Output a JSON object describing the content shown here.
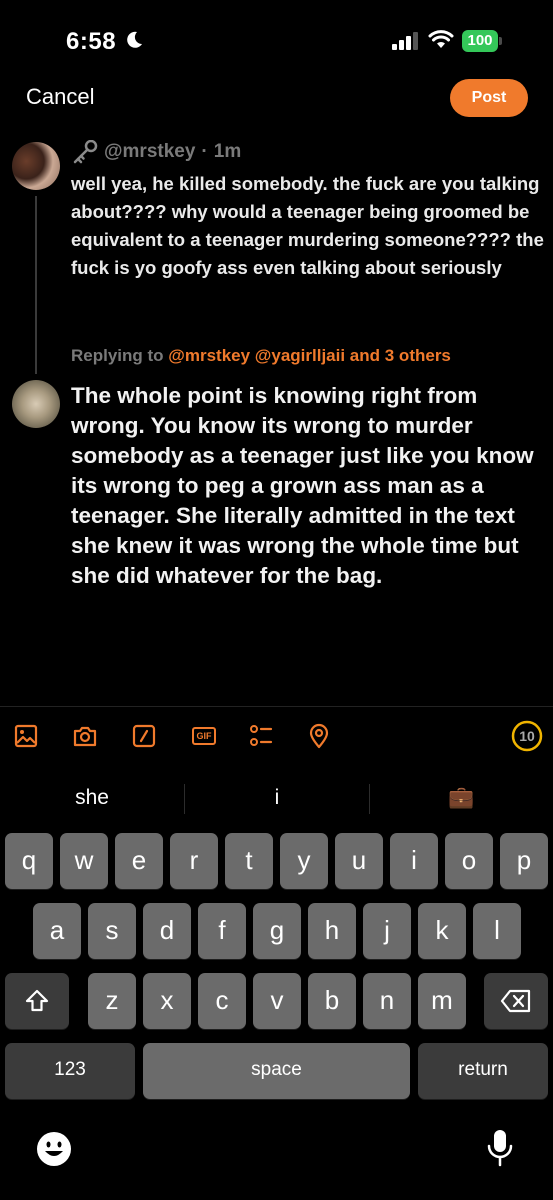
{
  "status_bar": {
    "time": "6:58",
    "battery": "100",
    "battery_color": "#34c759"
  },
  "header": {
    "cancel_label": "Cancel",
    "post_label": "Post",
    "accent_color": "#f07a2c"
  },
  "original_tweet": {
    "handle": "@mrstkey",
    "separator": "·",
    "time_ago": "1m",
    "text": "well yea, he killed somebody. the fuck are you talking about???? why would a teenager being groomed be equivalent to a teenager murdering someone???? the fuck is yo goofy ass even talking about seriously"
  },
  "reply": {
    "replying_prefix": "Replying to",
    "mentions": "@mrstkey @yagirlljaii and 3 others",
    "text": "The whole point is knowing right from wrong. You know its wrong to murder somebody as a teenager just like you know its wrong to peg a grown ass man as a teenager. She literally admitted in the text she knew it was wrong the whole time but she did whatever for the bag."
  },
  "toolbar": {
    "icons": [
      "image-icon",
      "camera-icon",
      "slash-icon",
      "gif-icon",
      "list-icon",
      "location-icon"
    ],
    "gif_label": "GIF",
    "counter": "10"
  },
  "keyboard": {
    "suggestions": [
      "she",
      "i",
      "💼"
    ],
    "row1": [
      "q",
      "w",
      "e",
      "r",
      "t",
      "y",
      "u",
      "i",
      "o",
      "p"
    ],
    "row2": [
      "a",
      "s",
      "d",
      "f",
      "g",
      "h",
      "j",
      "k",
      "l"
    ],
    "row3": [
      "z",
      "x",
      "c",
      "v",
      "b",
      "n",
      "m"
    ],
    "numbers_label": "123",
    "space_label": "space",
    "return_label": "return"
  }
}
